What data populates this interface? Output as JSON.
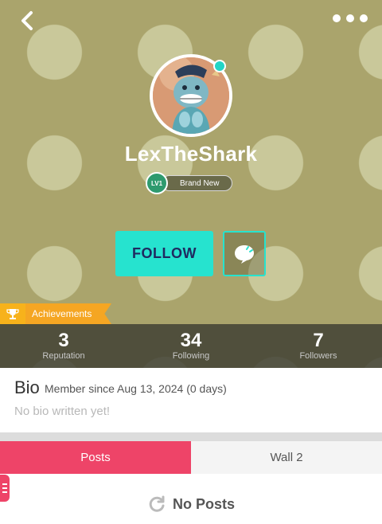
{
  "profile": {
    "username": "LexTheShark",
    "level_badge": "LV1",
    "level_title": "Brand New"
  },
  "actions": {
    "follow_label": "FOLLOW"
  },
  "achievements": {
    "label": "Achievements"
  },
  "stats": [
    {
      "value": "3",
      "label": "Reputation"
    },
    {
      "value": "34",
      "label": "Following"
    },
    {
      "value": "7",
      "label": "Followers"
    }
  ],
  "bio": {
    "title": "Bio",
    "member_since": "Member since Aug 13, 2024 (0 days)",
    "text": "No bio written yet!"
  },
  "tabs": [
    {
      "label": "Posts",
      "active": true
    },
    {
      "label": "Wall 2",
      "active": false
    }
  ],
  "posts": {
    "empty_label": "No Posts"
  },
  "colors": {
    "accent_teal": "#26e3cf",
    "accent_pink": "#ee4468",
    "achievement_orange": "#f5a623",
    "hero_bg": "#aaa46c"
  },
  "icons": {
    "back": "chevron-left-icon",
    "more": "more-dots-icon",
    "chat": "chat-bubble-icon",
    "trophy": "trophy-icon",
    "refresh": "refresh-icon"
  }
}
